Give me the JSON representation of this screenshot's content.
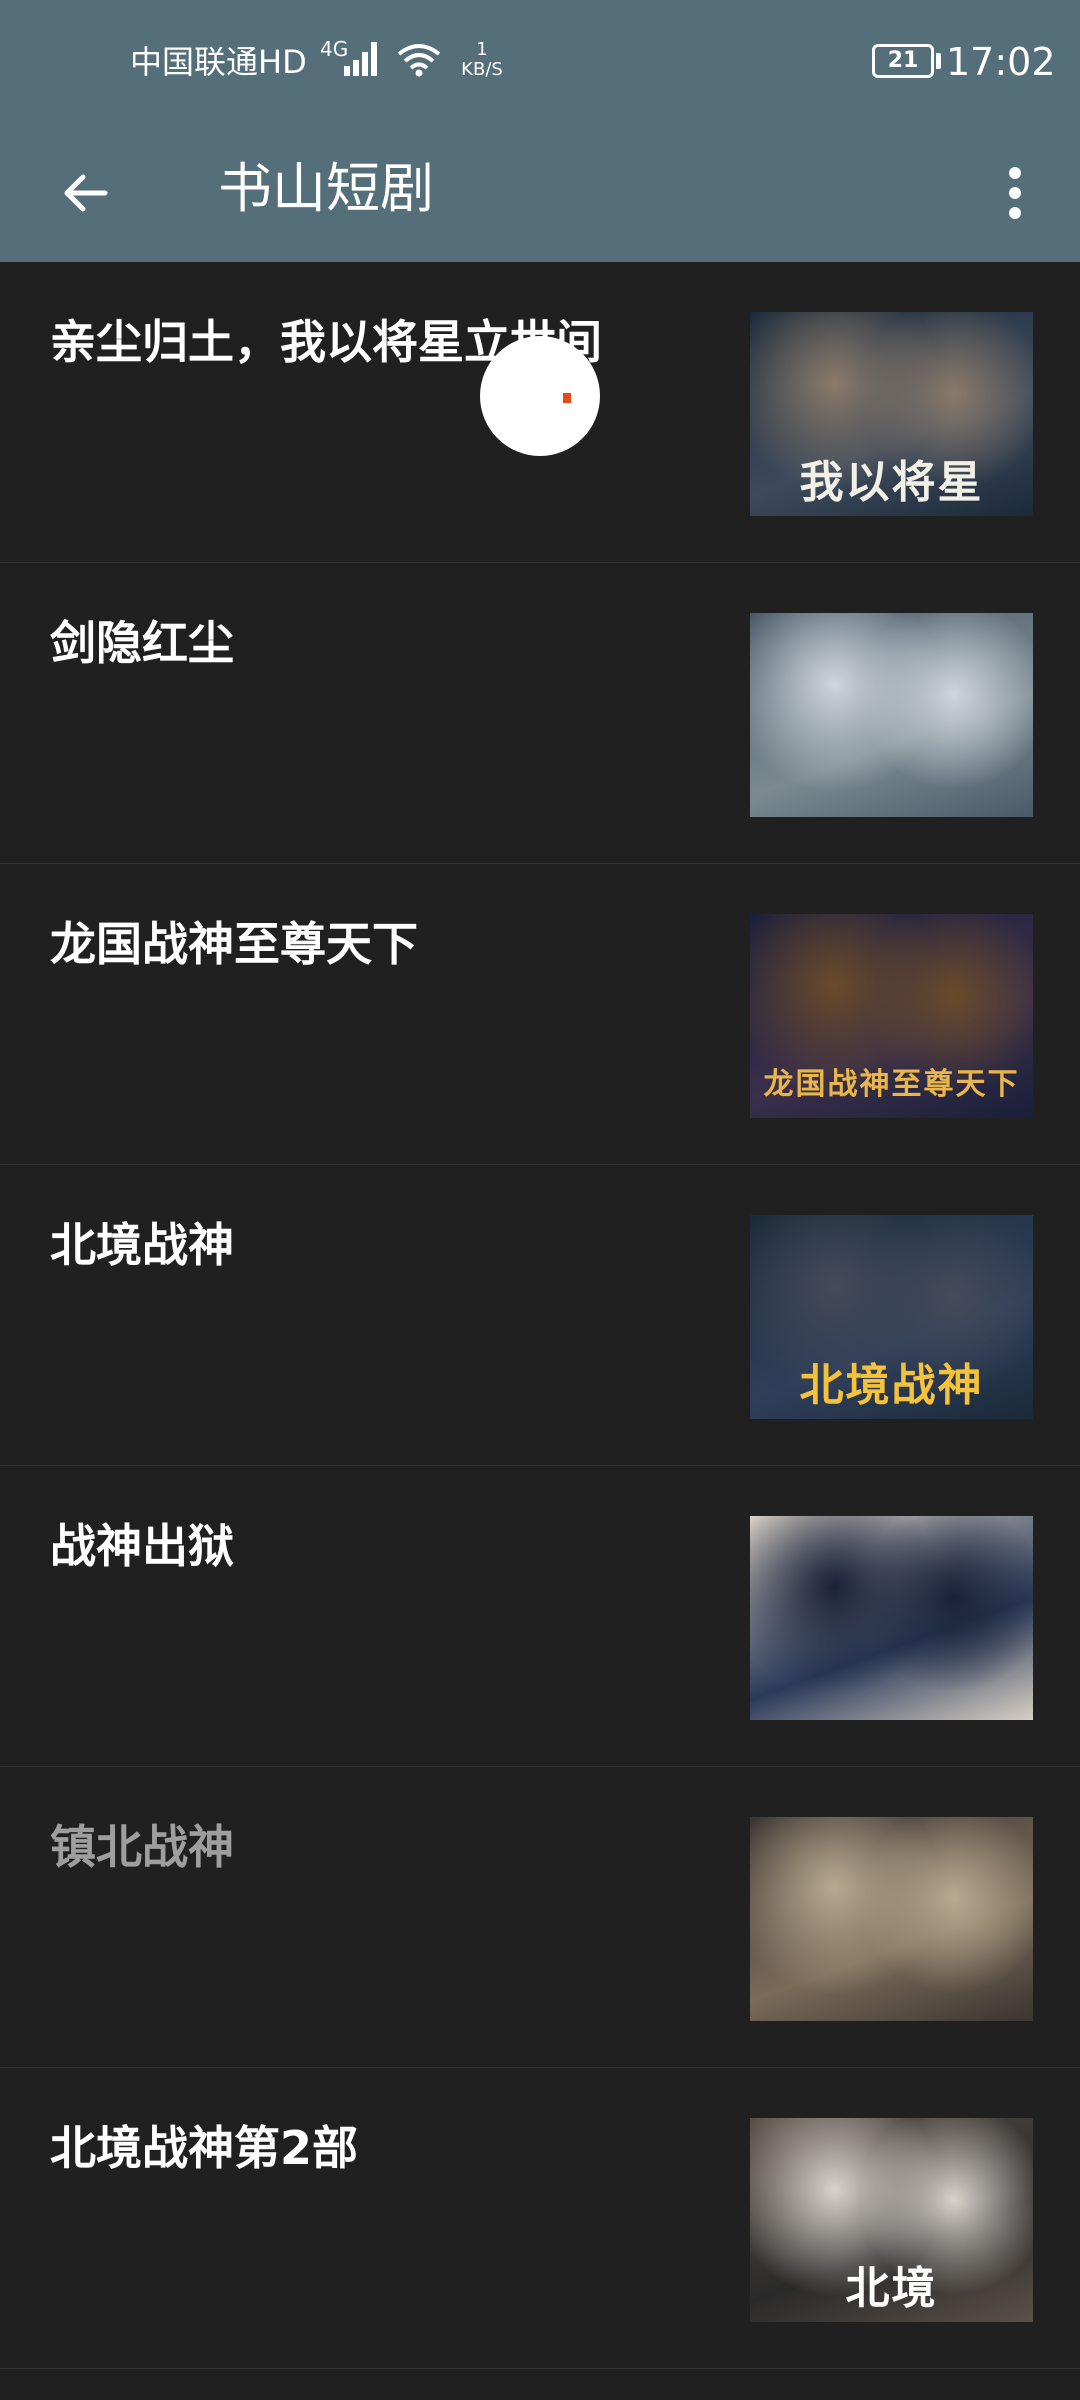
{
  "status_bar": {
    "carrier": "中国联通HD",
    "network_type": "4G",
    "speed_value": "1",
    "speed_unit": "KB/S",
    "battery": "21",
    "time": "17:02",
    "icons": [
      "signal-icon",
      "wifi-icon",
      "battery-icon"
    ]
  },
  "app_bar": {
    "title": "书山短剧",
    "icons": [
      "back-arrow-icon",
      "more-vert-icon"
    ]
  },
  "items": [
    {
      "title": "亲尘归土，我以将星立世间",
      "thumb_caption": "我以将星",
      "thumb_colors": [
        "#1b2a3a",
        "#3d4a5c",
        "#8a7a6a"
      ],
      "caption_color": "#f2efe6"
    },
    {
      "title": "剑隐红尘",
      "thumb_caption": "",
      "thumb_colors": [
        "#4a5a6a",
        "#7a8a90",
        "#cfd6dc"
      ],
      "caption_color": "#ffffff"
    },
    {
      "title": "龙国战神至尊天下",
      "thumb_caption": "龙国战神至尊天下",
      "thumb_colors": [
        "#1a1f3a",
        "#3a2f4a",
        "#6a4a2a"
      ],
      "caption_color": "#e8b64a"
    },
    {
      "title": "北境战神",
      "thumb_caption": "北境战神",
      "thumb_colors": [
        "#1a2a3a",
        "#2f3f5a",
        "#444a5a"
      ],
      "caption_color": "#f5c23a"
    },
    {
      "title": "战神出狱",
      "thumb_caption": "",
      "thumb_colors": [
        "#d8cfc4",
        "#2a3a5a",
        "#1a2238"
      ],
      "caption_color": "#ffffff"
    },
    {
      "title": "镇北战神",
      "thumb_caption": "",
      "thumb_colors": [
        "#3a3530",
        "#7a6a58",
        "#b8a990"
      ],
      "caption_color": "#ffffff",
      "dim": true
    },
    {
      "title": "北境战神第2部",
      "thumb_caption": "北境",
      "thumb_colors": [
        "#5a5048",
        "#2a2a2a",
        "#d8d2cc"
      ],
      "caption_color": "#ffffff"
    }
  ]
}
